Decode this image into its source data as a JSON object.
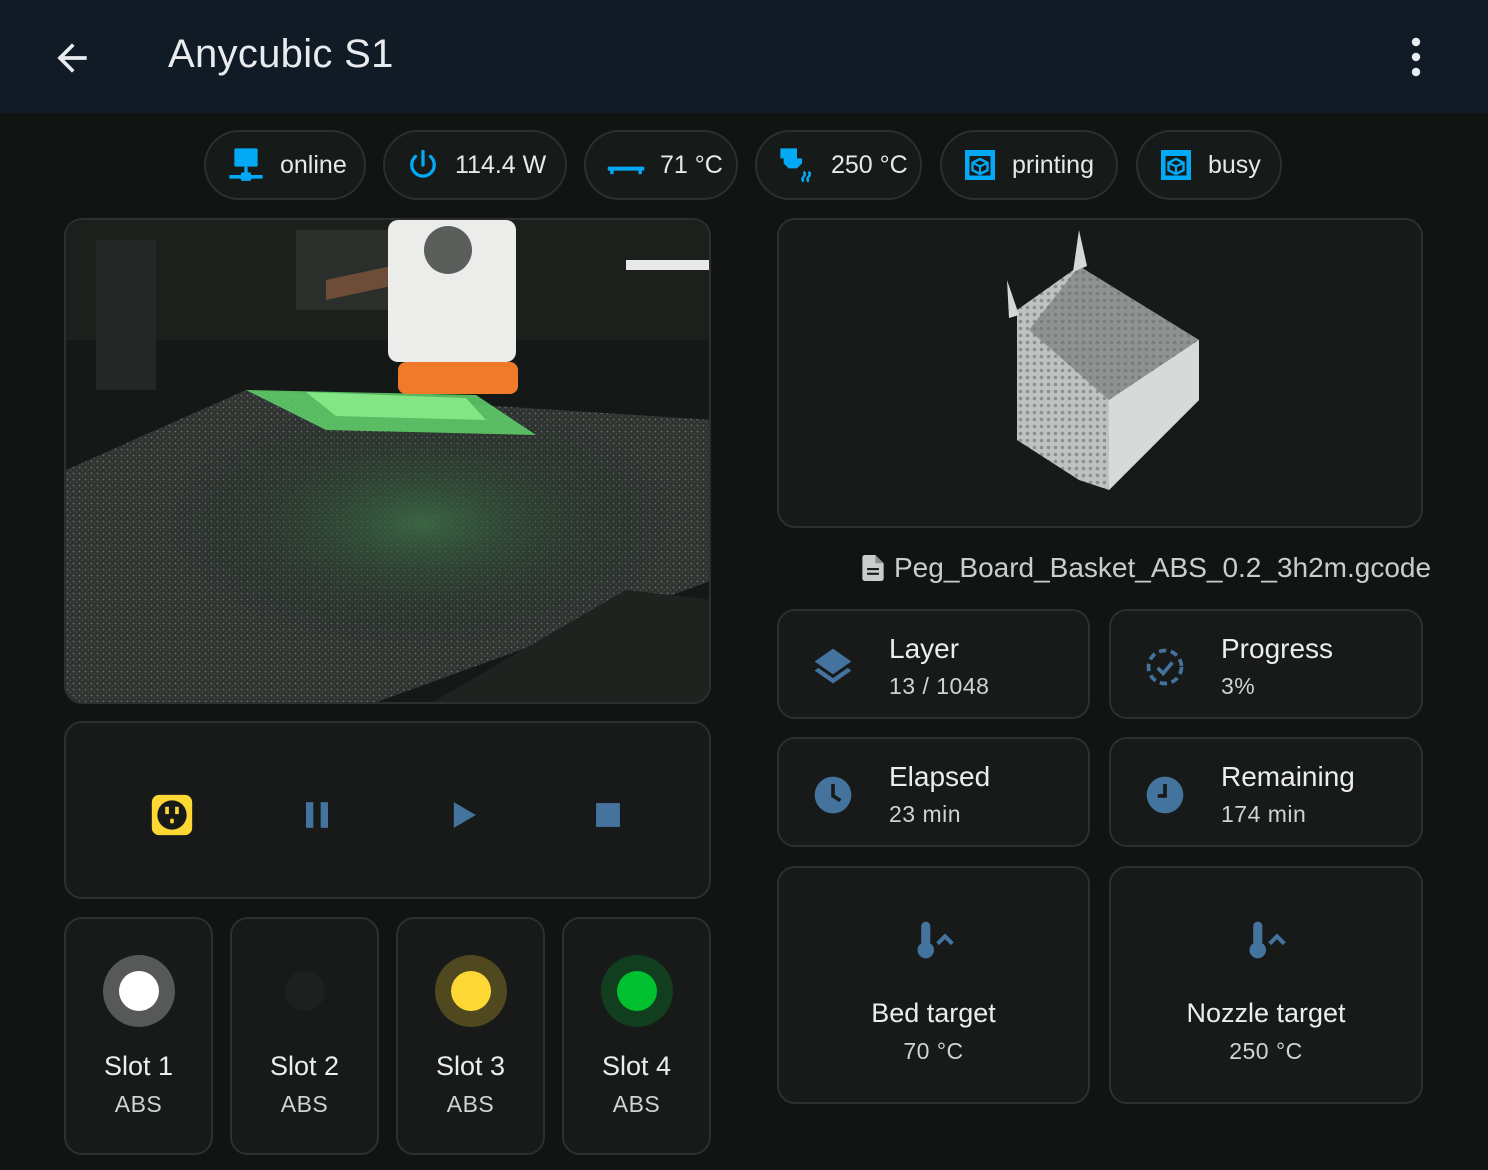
{
  "header": {
    "title": "Anycubic S1"
  },
  "chips": [
    {
      "label": "online",
      "icon": "monitor-network-icon"
    },
    {
      "label": "114.4 W",
      "icon": "power-icon"
    },
    {
      "label": "71 °C",
      "icon": "printer-bed-icon"
    },
    {
      "label": "250 °C",
      "icon": "printer-nozzle-heat-icon"
    },
    {
      "label": "printing",
      "icon": "printer-3d-icon"
    },
    {
      "label": "busy",
      "icon": "printer-3d-icon"
    }
  ],
  "file": {
    "name": "Peg_Board_Basket_ABS_0.2_3h2m.gcode"
  },
  "stats": {
    "layer": {
      "label": "Layer",
      "value": "13 / 1048"
    },
    "progress": {
      "label": "Progress",
      "value": "3%"
    },
    "elapsed": {
      "label": "Elapsed",
      "value": "23 min"
    },
    "remaining": {
      "label": "Remaining",
      "value": "174 min"
    }
  },
  "targets": {
    "bed": {
      "label": "Bed target",
      "value": "70 °C"
    },
    "nozzle": {
      "label": "Nozzle target",
      "value": "250 °C"
    }
  },
  "slots": [
    {
      "name": "Slot 1",
      "material": "ABS",
      "color": "#ffffff"
    },
    {
      "name": "Slot 2",
      "material": "ABS",
      "color": "#1a1d1b"
    },
    {
      "name": "Slot 3",
      "material": "ABS",
      "color": "#fdd835"
    },
    {
      "name": "Slot 4",
      "material": "ABS",
      "color": "#00c030"
    }
  ],
  "colors": {
    "accent_blue": "#03a9f4",
    "muted_blue": "#44739e",
    "plug_yellow": "#fdd835",
    "header_bg": "#101b26"
  }
}
